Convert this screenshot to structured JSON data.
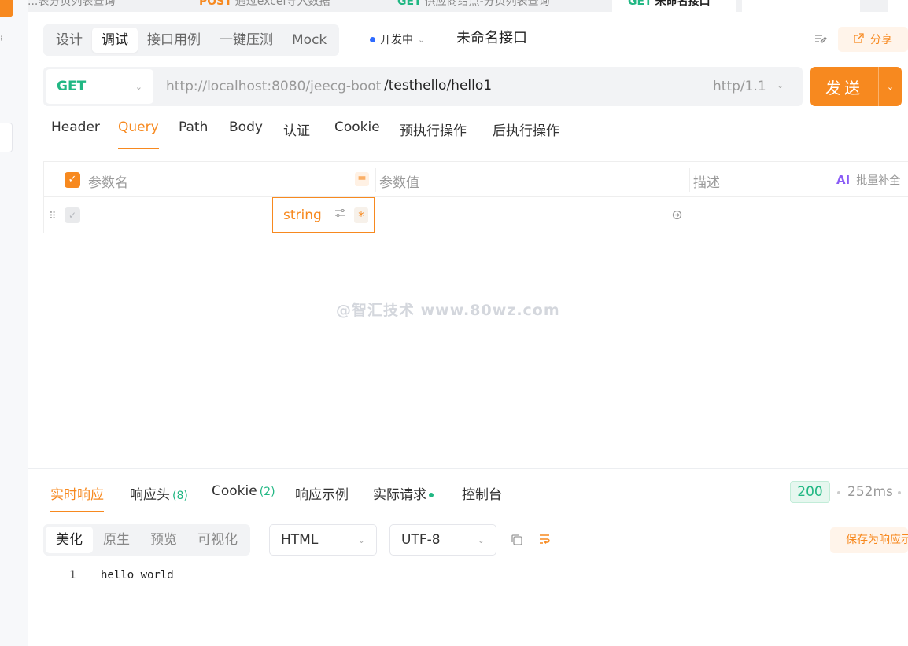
{
  "top_tabs": [
    {
      "method": "",
      "label": "...表分页列表查询"
    },
    {
      "method": "POST",
      "label": "通过excel导入数据"
    },
    {
      "method": "GET",
      "label": "供应商给点-分页列表查询"
    },
    {
      "method": "GET",
      "label": "未命名接口"
    }
  ],
  "mode_tabs": [
    "设计",
    "调试",
    "接口用例",
    "一键压测",
    "Mock"
  ],
  "env": {
    "label": "开发中"
  },
  "api_name": "未命名接口",
  "share_label": "分享",
  "request": {
    "method": "GET",
    "base_url": "http://localhost:8080/jeecg-boot",
    "path": "/testhello/hello1",
    "protocol": "http/1.1",
    "send_label": "发送"
  },
  "request_tabs": [
    "Header",
    "Query",
    "Path",
    "Body",
    "认证",
    "Cookie",
    "预执行操作",
    "后执行操作"
  ],
  "params_table": {
    "col_name": "参数名",
    "eq_symbol": "=",
    "col_value": "参数值",
    "col_desc": "描述",
    "ai_badge": "AI",
    "bulk_fill": "批量补全",
    "row": {
      "type": "string",
      "required_mark": "*"
    }
  },
  "watermark": "@智汇技术 www.80wz.com",
  "response_tabs": {
    "realtime": "实时响应",
    "headers": "响应头",
    "headers_count": "(8)",
    "cookie": "Cookie",
    "cookie_count": "(2)",
    "example": "响应示例",
    "actual_request": "实际请求",
    "console": "控制台"
  },
  "status_code": "200",
  "elapsed": "252ms",
  "view_modes": [
    "美化",
    "原生",
    "预览",
    "可视化"
  ],
  "format": "HTML",
  "encoding": "UTF-8",
  "save_as_response": "保存为响应示例",
  "response_body": [
    {
      "line": "1",
      "text": "hello world"
    }
  ],
  "colors": {
    "accent": "#f7891f",
    "get": "#21b783",
    "status_ok": "#21b783",
    "env_dot": "#2f6bff"
  }
}
